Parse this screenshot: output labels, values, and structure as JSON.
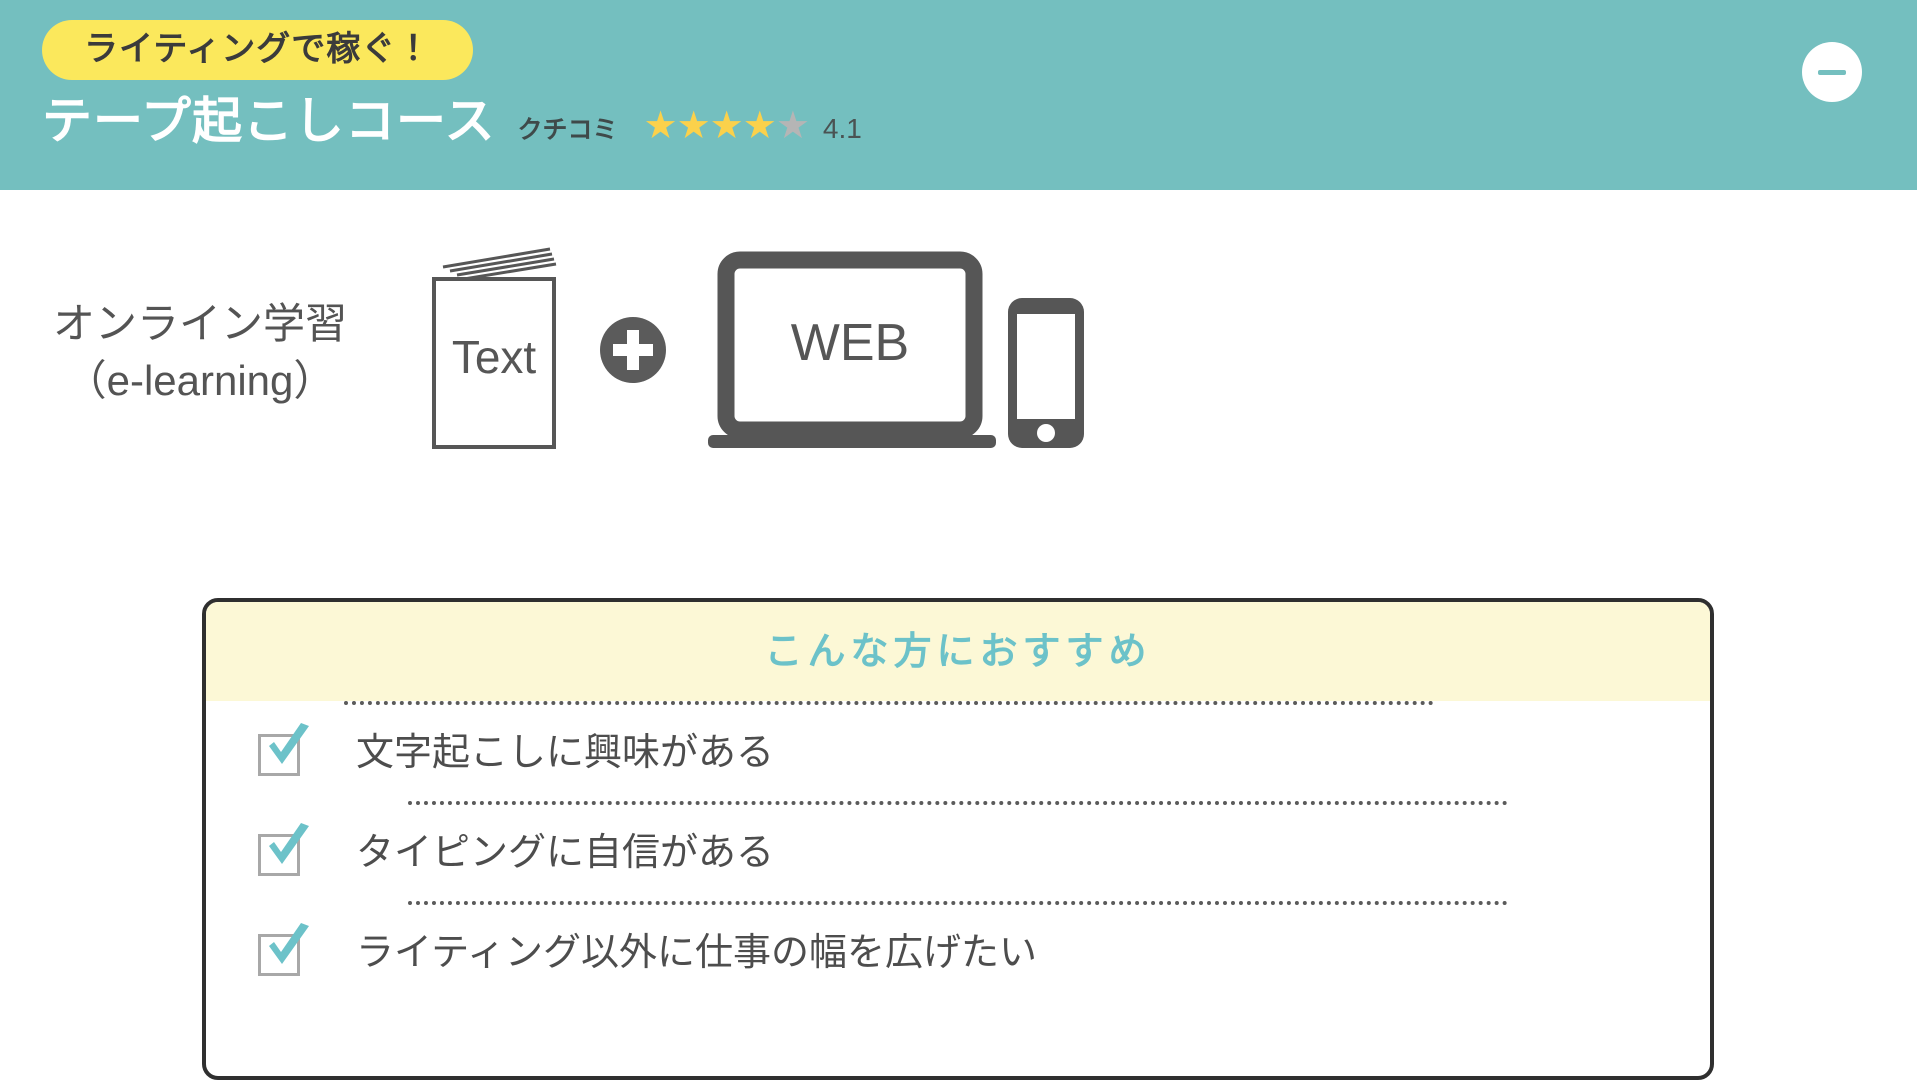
{
  "header": {
    "badge_label": "ライティングで稼ぐ！",
    "course_title": "テープ起こしコース",
    "review_label": "クチコミ",
    "rating_value": "4.1",
    "stars_filled": 4,
    "stars_total": 5,
    "minimize_icon": "minus-icon",
    "background_color": "#74bfbf",
    "badge_color": "#fbe85c",
    "star_on_color": "#fbd14b",
    "star_off_color": "#b5b5b5"
  },
  "media": {
    "elearning_line1": "オンライン学習",
    "elearning_line2": "（e-learning）",
    "text_book_label": "Text",
    "plus_icon": "plus-circle-icon",
    "web_label": "WEB",
    "laptop_icon": "laptop-icon",
    "smartphone_icon": "smartphone-icon"
  },
  "recommend": {
    "heading": "こんな方におすすめ",
    "heading_color": "#6cc2c9",
    "header_background": "#fcf8d6",
    "border_color": "#2f2f2f",
    "items": [
      {
        "label": "文字起こしに興味がある",
        "checked": true
      },
      {
        "label": "タイピングに自信がある",
        "checked": true
      },
      {
        "label": "ライティング以外に仕事の幅を広げたい",
        "checked": true
      }
    ]
  }
}
